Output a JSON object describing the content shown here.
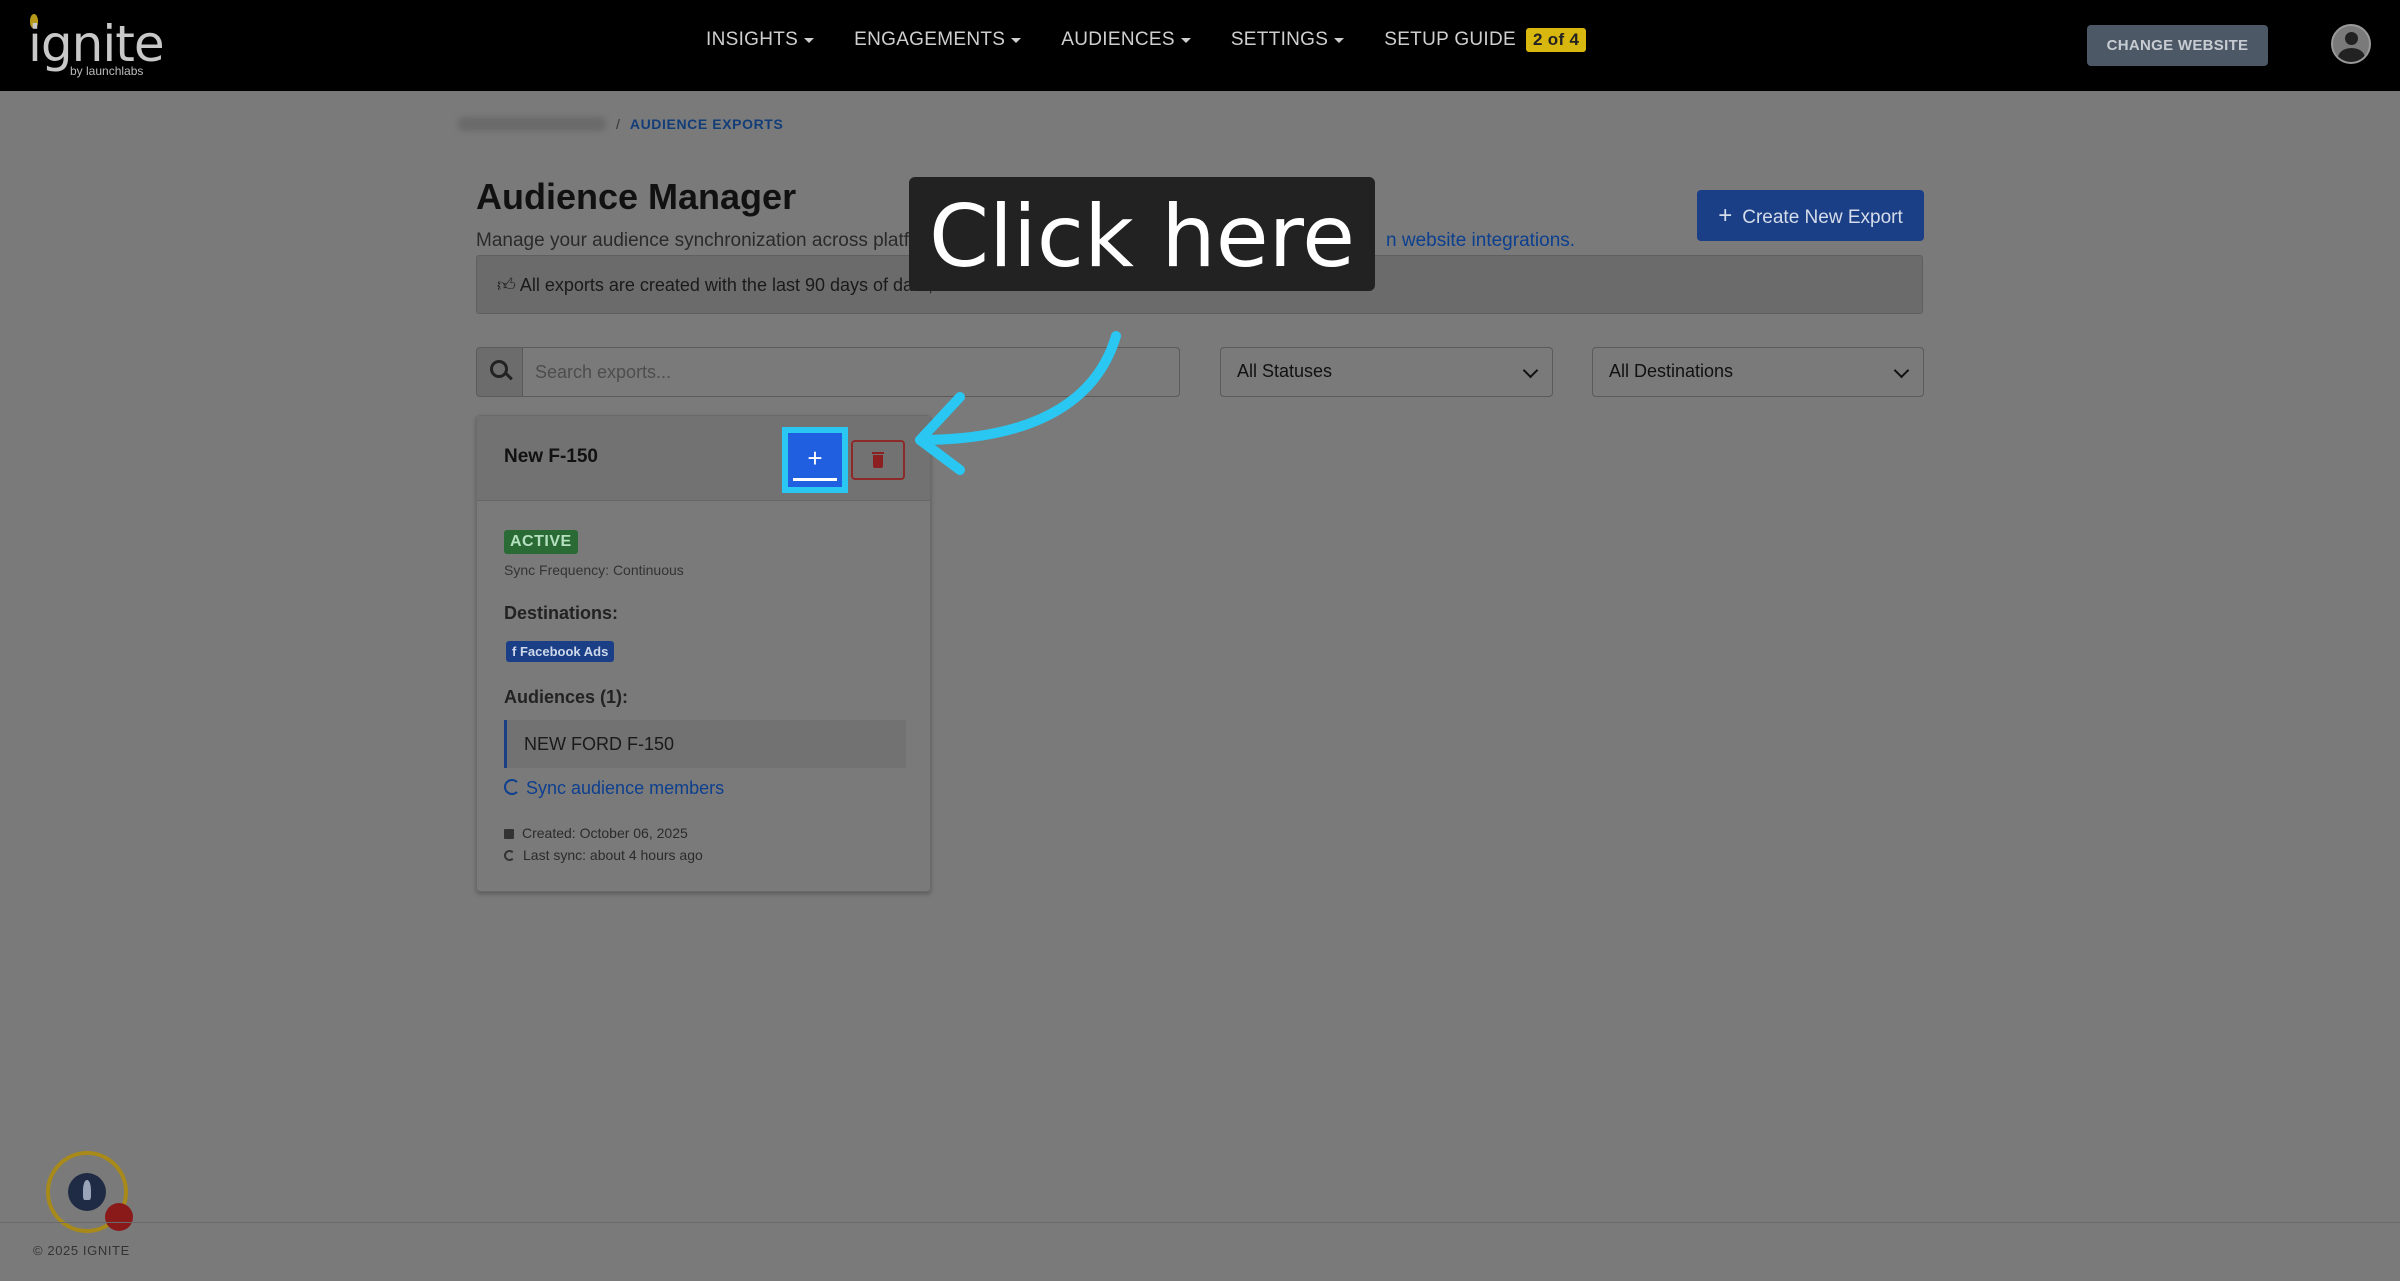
{
  "nav": {
    "logo_text": "ignite",
    "logo_sub": "by launchlabs",
    "menu": [
      "INSIGHTS",
      "ENGAGEMENTS",
      "AUDIENCES",
      "SETTINGS"
    ],
    "setup_label": "SETUP GUIDE",
    "setup_badge": "2 of 4",
    "change_website": "CHANGE WEBSITE"
  },
  "breadcrumb": {
    "separator": "/",
    "current": "AUDIENCE EXPORTS"
  },
  "header": {
    "title": "Audience Manager",
    "description": "Manage your audience synchronization across platfor",
    "description_link": "n website integrations.",
    "create_button": "Create New Export",
    "create_icon": "+"
  },
  "info": {
    "text": "All exports are created with the last 90 days of data, as available."
  },
  "filters": {
    "search_placeholder": "Search exports...",
    "status_selected": "All Statuses",
    "destination_selected": "All Destinations"
  },
  "card": {
    "title": "New F-150",
    "add_icon": "+",
    "status": "ACTIVE",
    "sync_frequency": "Sync Frequency: Continuous",
    "destinations_label": "Destinations:",
    "destination_badge": "f  Facebook Ads",
    "audiences_label": "Audiences (1):",
    "audience_item": "NEW FORD F-150",
    "sync_link": "Sync audience members",
    "created": "Created: October 06, 2025",
    "last_sync": "Last sync: about 4 hours ago"
  },
  "overlay": {
    "tooltip": "Click here",
    "arrow_color": "#29c7f2"
  },
  "footer": {
    "copyright": "© 2025 IGNITE"
  }
}
